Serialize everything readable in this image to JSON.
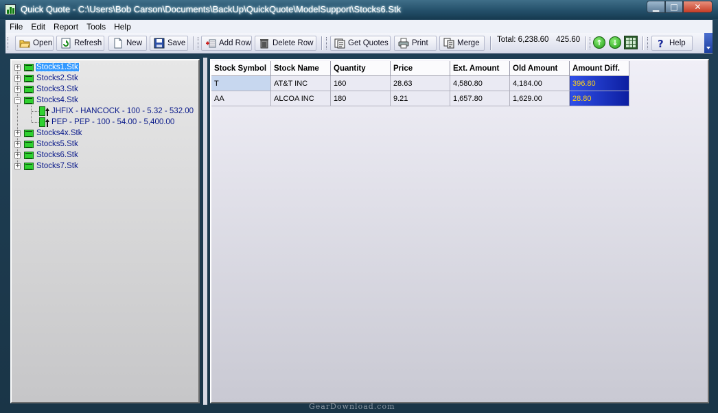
{
  "window": {
    "title": "Quick Quote - C:\\Users\\Bob Carson\\Documents\\BackUp\\QuickQuote\\ModelSupport\\Stocks6.Stk",
    "controls": {
      "minimize": "▁",
      "maximize": "□",
      "close": "✕"
    }
  },
  "menu": [
    "File",
    "Edit",
    "Report",
    "Tools",
    "Help"
  ],
  "toolbar": {
    "open": "Open",
    "refresh": "Refresh",
    "new": "New",
    "save": "Save",
    "add_row": "Add Row",
    "delete_row": "Delete Row",
    "get_quotes": "Get Quotes",
    "print": "Print",
    "merge": "Merge",
    "total_label": "Total: 6,238.60",
    "total_diff": "425.60",
    "up_glyph": "↑",
    "down_glyph": "↓",
    "help": "Help"
  },
  "tree": {
    "expand_glyph": "+",
    "collapse_glyph": "−",
    "nodes": [
      {
        "label": "Stocks1.Stk",
        "expanded": false,
        "selected": true
      },
      {
        "label": "Stocks2.Stk",
        "expanded": false
      },
      {
        "label": "Stocks3.Stk",
        "expanded": false
      },
      {
        "label": "Stocks4.Stk",
        "expanded": true,
        "children": [
          {
            "label": "JHFIX - HANCOCK - 100 - 5.32 - 532.00"
          },
          {
            "label": "PEP - PEP - 100 - 54.00 - 5,400.00"
          }
        ]
      },
      {
        "label": "Stocks4x.Stk",
        "expanded": false
      },
      {
        "label": "Stocks5.Stk",
        "expanded": false
      },
      {
        "label": "Stocks6.Stk",
        "expanded": false
      },
      {
        "label": "Stocks7.Stk",
        "expanded": false
      }
    ]
  },
  "grid": {
    "columns": [
      "Stock Symbol",
      "Stock Name",
      "Quantity",
      "Price",
      "Ext. Amount",
      "Old Amount",
      "Amount Diff."
    ],
    "rows": [
      [
        "T",
        "AT&T INC",
        "160",
        "28.63",
        "4,580.80",
        "4,184.00",
        "396.80"
      ],
      [
        "AA",
        "ALCOA INC",
        "180",
        "9.21",
        "1,657.80",
        "1,629.00",
        "28.80"
      ]
    ]
  },
  "watermark": "GearDownload.com",
  "colors": {
    "titlebar": "#24506a",
    "diff_bg": "#1c30c8",
    "diff_text": "#ffd21a",
    "tree_link": "#0a1a8a",
    "selection": "#3399ff"
  }
}
